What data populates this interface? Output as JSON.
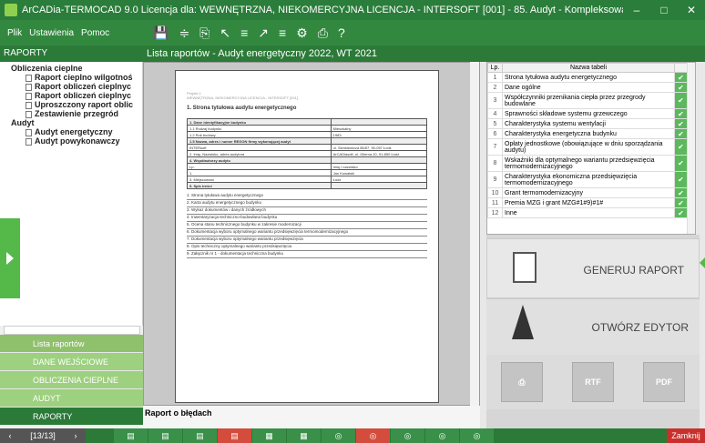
{
  "window": {
    "title": "ArCADia-TERMOCAD 9.0 Licencja dla: WEWNĘTRZNA, NIEKOMERCYJNA LICENCJA - INTERSOFT [001] - 85. Audyt - Kompleksowa modernizacja z ogranicz. środków",
    "minimize": "–",
    "maximize": "□",
    "close": "✕"
  },
  "menu": {
    "file": "Plik",
    "settings": "Ustawienia",
    "help": "Pomoc"
  },
  "section_title": "RAPORTY",
  "toolbar": [
    "💾",
    "≑",
    "⎘",
    "↖",
    "≡",
    "↗",
    "≡",
    "⚙",
    "⎙",
    "?"
  ],
  "breadcrumb": "Lista raportów - Audyt energetyczny 2022, WT 2021",
  "tree": [
    {
      "label": "Obliczenia cieplne",
      "indent": 12,
      "bold": true,
      "doc": false
    },
    {
      "label": "Raport cieplno wilgotnoś",
      "indent": 28,
      "bold": true,
      "doc": true
    },
    {
      "label": "Raport obliczeń cieplnyc",
      "indent": 28,
      "bold": true,
      "doc": true
    },
    {
      "label": "Raport obliczeń cieplnyc",
      "indent": 28,
      "bold": true,
      "doc": true
    },
    {
      "label": "Uproszczony raport oblic",
      "indent": 28,
      "bold": true,
      "doc": true
    },
    {
      "label": "Zestawienie przegród",
      "indent": 28,
      "bold": true,
      "doc": true
    },
    {
      "label": "Audyt",
      "indent": 12,
      "bold": true,
      "doc": false
    },
    {
      "label": "Audyt energetyczny",
      "indent": 28,
      "bold": true,
      "doc": true
    },
    {
      "label": "Audyt powykonawczy",
      "indent": 28,
      "bold": true,
      "doc": true
    }
  ],
  "nav": [
    "Lista raportów",
    "DANE WEJŚCIOWE",
    "OBLICZENIA CIEPLNE",
    "AUDYT",
    "RAPORTY"
  ],
  "document": {
    "header": "Projekt 1",
    "subheader": "WEWNĘTRZNA, NIEKOMERCYJNA LICENCJA - INTERSOFT [001]",
    "heading": "1. Strona tytułowa audytu energetycznego",
    "rows": [
      [
        "1. Dane identyfikacyjne budynku",
        ""
      ],
      [
        "1.1 Rodzaj budynku",
        "Mieszkalny"
      ],
      [
        "1.2 Rok budowy",
        "1983"
      ],
      [
        "1.5 Nazwa, adres i numer REGON firmy wykonującej audyt",
        ""
      ],
      [
        "INTERsoft",
        "ul. Sienkiewicza 85/87, 90-057 Łódź"
      ],
      [
        "2. Imię, Nazwisko, adres audytora",
        "ArCADiasoft, ul. Gilerna 10, 91-850 Łódź"
      ],
      [
        "4. Współautorzy audytu",
        ""
      ],
      [
        "Lp.",
        "Imię i nazwisko"
      ],
      [
        "1.",
        "Jan Kowalski"
      ],
      [
        "3. Miejscowość",
        "Łódź"
      ],
      [
        "5. Spis treści",
        ""
      ]
    ],
    "toc": [
      "1. Strona tytułowa audytu energetycznego",
      "2. Karta audytu energetycznego budynku",
      "3. Wykaz dokumentów i danych źródłowych",
      "4. Inwentaryzacja techniczno-budowlana budynku",
      "5. Ocena stanu technicznego budynku w zakresie modernizacji",
      "6. Dokumentacja wyboru optymalnego wariantu przedsięwzięcia termomodernizacyjnego",
      "7. Dokumentacja wyboru optymalnego wariantu przedsięwzięcia",
      "8. Opis techniczny optymalnego wariantu przedsięwzięcia",
      "9. Załącznik nr 1 - dokumentacja techniczna budynku"
    ]
  },
  "report_label": "Raport o błędach",
  "table": {
    "col_lp": "Lp.",
    "col_name": "Nazwa tabeli",
    "rows": [
      {
        "lp": "1",
        "name": "Strona tytułowa audytu energetycznego",
        "h": 11
      },
      {
        "lp": "2",
        "name": "Dane ogólne",
        "h": 11
      },
      {
        "lp": "3",
        "name": "Współczynniki przenikania ciepła przez przegrody budowlane",
        "h": 18
      },
      {
        "lp": "4",
        "name": "Sprawności składowe systemu grzewczego",
        "h": 11
      },
      {
        "lp": "5",
        "name": "Charakterystyka systemu wentylacji",
        "h": 11
      },
      {
        "lp": "6",
        "name": "Charakterystyka energetyczna budynku",
        "h": 11
      },
      {
        "lp": "7",
        "name": "Opłaty jednostkowe (obowiązujące w dniu sporządzania audytu)",
        "h": 18
      },
      {
        "lp": "8",
        "name": "Wskaźniki dla optymalnego wariantu przedsięwzięcia termomodernizacyjnego",
        "h": 18
      },
      {
        "lp": "9",
        "name": "Charakterystyka ekonomiczna przedsięwzięcia termomodernizacyjnego",
        "h": 18
      },
      {
        "lp": "10",
        "name": "Grant termomodernizacyjny",
        "h": 11
      },
      {
        "lp": "11",
        "name": "Premia MZG i grant MZG#1#9)#1#",
        "h": 11
      },
      {
        "lp": "12",
        "name": "Inne",
        "h": 11
      }
    ]
  },
  "actions": {
    "generate": "GENERUJ RAPORT",
    "open_editor": "OTWÓRZ EDYTOR",
    "print": "⎙",
    "rtf": "RTF",
    "pdf": "PDF"
  },
  "bottom": {
    "page": "[13/13]",
    "prev": "‹",
    "next": "›",
    "close": "Zamknij"
  }
}
